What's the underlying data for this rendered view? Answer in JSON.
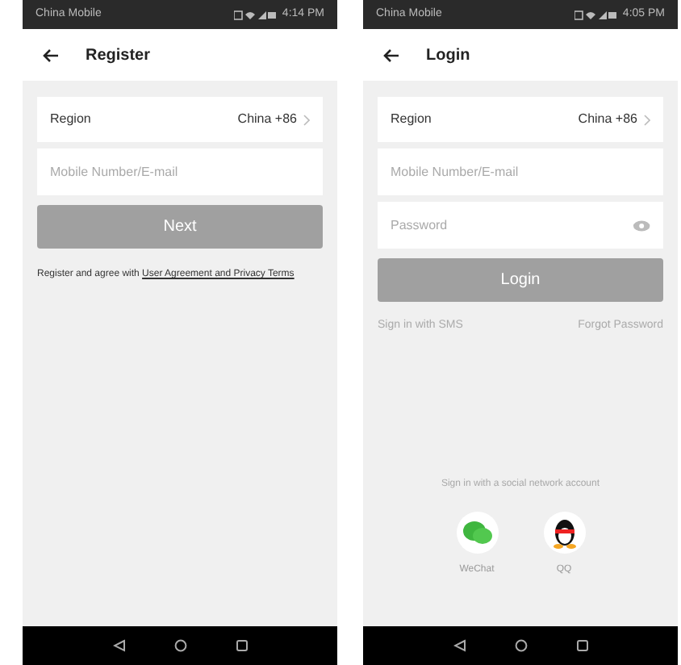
{
  "screens": [
    {
      "status_bar": {
        "carrier": "China Mobile",
        "time": "4:14 PM"
      },
      "header": {
        "title": "Register"
      },
      "region": {
        "label": "Region",
        "value": "China +86"
      },
      "fields": [
        {
          "placeholder": "Mobile Number/E-mail",
          "kind": "text"
        }
      ],
      "primary_button": "Next",
      "agreement": "Register and agree with ",
      "agreement_link": "User Agreement and Privacy Terms"
    },
    {
      "status_bar": {
        "carrier": "China Mobile",
        "time": "4:05 PM"
      },
      "header": {
        "title": "Login"
      },
      "region": {
        "label": "Region",
        "value": "China +86"
      },
      "fields": [
        {
          "placeholder": "Mobile Number/E-mail",
          "kind": "text"
        },
        {
          "placeholder": "Password",
          "kind": "password"
        }
      ],
      "primary_button": "Login",
      "links": [
        "Sign in with SMS",
        "Forgot Password"
      ],
      "social_title": "Sign in with a social network account",
      "social": [
        {
          "label": "WeChat",
          "kind": "wechat"
        },
        {
          "label": "QQ",
          "kind": "qq"
        }
      ]
    }
  ]
}
